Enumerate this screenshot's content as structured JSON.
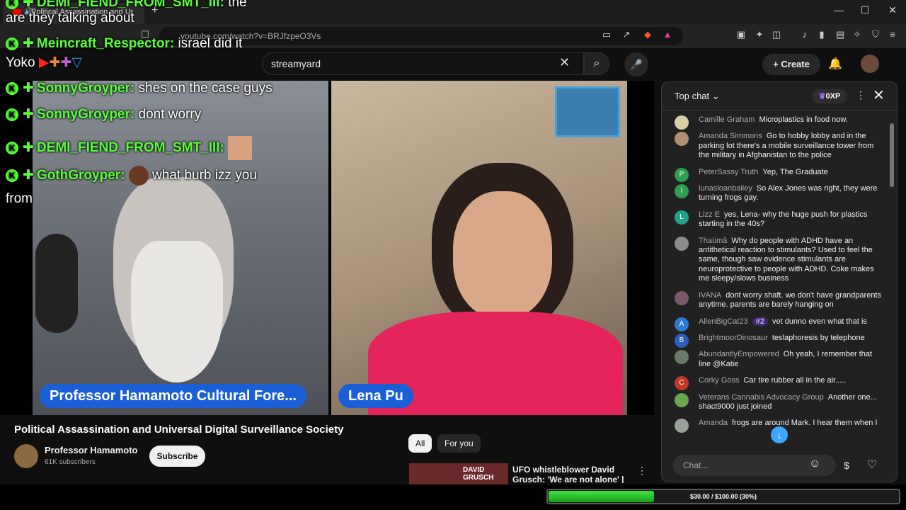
{
  "browser": {
    "tab_title": "Political Assassination and Ur",
    "url": "youtube.com/watch?v=BRJfzpeO3Vs",
    "window_controls": [
      "minimize",
      "maximize",
      "close"
    ]
  },
  "youtube": {
    "search_value": "streamyard",
    "create_label": "Create"
  },
  "video": {
    "left_nametag": "Professor Hamamoto Cultural Fore...",
    "right_nametag": "Lena Pu",
    "title": "Political Assassination and Universal Digital Surveillance Society",
    "channel_name": "Professor Hamamoto",
    "subscribers": "61K subscribers",
    "subscribe_label": "Subscribe"
  },
  "overlay_chat": [
    {
      "user": "DEMI_FIEND_FROM_SMT_III:",
      "text": "the"
    },
    {
      "user": "",
      "text": "are they talking about"
    },
    {
      "user": "Meincraft_Respector:",
      "text": "israel did it"
    },
    {
      "user": "",
      "text": "Yoko"
    },
    {
      "user": "SonnyGroyper:",
      "text": "shes on the case guys"
    },
    {
      "user": "SonnyGroyper:",
      "text": "dont worry"
    },
    {
      "user": "DEMI_FIEND_FROM_SMT_III:",
      "text": ""
    },
    {
      "user": "GothGroyper:",
      "text": "what burb izz you"
    },
    {
      "user": "",
      "text": "from"
    }
  ],
  "recommendations": {
    "chips": [
      "All",
      "For you"
    ],
    "first_title": "UFO whistleblower David Grusch: 'We are not alone' |",
    "thumb_text": "DAVID GRUSCH"
  },
  "live_chat": {
    "header": "Top chat",
    "xp": "0XP",
    "input_placeholder": "Chat...",
    "messages": [
      {
        "author": "Camille Graham",
        "text": "Microplastics in food now.",
        "avatar": "",
        "color": "#d8cfa8"
      },
      {
        "author": "Amanda Simmons",
        "text": "Go to hobby lobby and in the parking lot there's a mobile surveillance tower from the military in Afghanistan to the police",
        "avatar": "",
        "color": "#b09070"
      },
      {
        "author": "PeterSassy Truth",
        "text": "Yep, The Graduate",
        "avatar": "P",
        "color": "#2e9e4f"
      },
      {
        "author": "lunasloanbailey",
        "text": "So Alex Jones was right, they were turning frogs gay.",
        "avatar": "l",
        "color": "#2e9e4f"
      },
      {
        "author": "Lizz E",
        "text": "yes, Lena- why the huge push for plastics starting in the 40s?",
        "avatar": "L",
        "color": "#21a38a"
      },
      {
        "author": "Thaümâ",
        "text": "Why do people with ADHD have an antithetical reaction to stimulants? Used to feel the same, though saw evidence stimulants are neuroprotective to people with ADHD. Coke makes me sleepy/slows business",
        "avatar": "",
        "color": "#8c8c8c"
      },
      {
        "author": "IVANA",
        "text": "dont worry shaft. we don't have grandparents anytime. parents are barely hanging on",
        "avatar": "",
        "color": "#7a5a6a"
      },
      {
        "author": "AllenBigCat23",
        "badge": "#2",
        "text": "vet dunno even what that is",
        "avatar": "A",
        "color": "#2b7bd6"
      },
      {
        "author": "BrightmoorDinosaur",
        "text": "teslaphoresis by telephone",
        "avatar": "B",
        "color": "#2b5fbf"
      },
      {
        "author": "AbundantlyEmpowered",
        "text": "Oh yeah, I remember that line @Katie",
        "avatar": "",
        "color": "#6a7a6a"
      },
      {
        "author": "Corky Goss",
        "text": "Car tire rubber all in the air.....",
        "avatar": "C",
        "color": "#c0392b"
      },
      {
        "author": "Veterans Cannabis Advocacy Group",
        "text": "Another one... shact9000 just joined",
        "avatar": "",
        "color": "#6aa84f"
      },
      {
        "author": "Amanda",
        "text": "frogs are around Mark. I hear them when I",
        "avatar": "",
        "color": "#9aa09a"
      }
    ]
  },
  "goal": {
    "text": "$30.00 / $100.00 (30%)",
    "progress": 0.3
  }
}
